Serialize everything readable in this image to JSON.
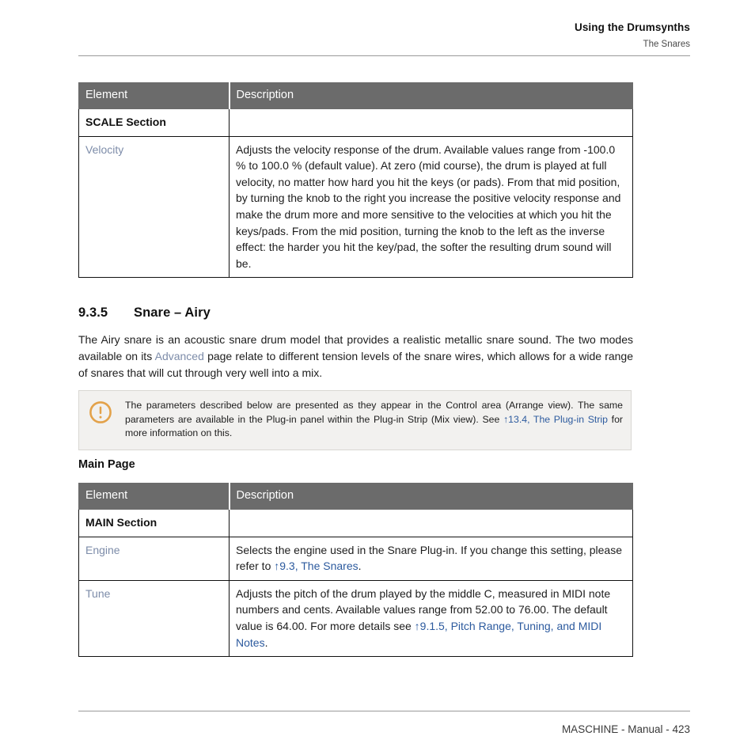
{
  "running_head": {
    "title": "Using the Drumsynths",
    "subtitle": "The Snares"
  },
  "tables": {
    "scale_table": {
      "columns": [
        "Element",
        "Description"
      ],
      "rows": [
        {
          "element": "SCALE Section",
          "element_style": "section",
          "description": ""
        },
        {
          "element": "Velocity",
          "element_style": "param",
          "description": "Adjusts the velocity response of the drum. Available values range from -100.0 % to 100.0 % (default value). At zero (mid course), the drum is played at full velocity, no matter how hard you hit the keys (or pads). From that mid position, by turning the knob to the right you increase the positive velocity response and make the drum more and more sensitive to the velocities at which you hit the keys/pads. From the mid position, turning the knob to the left as the inverse effect: the harder you hit the key/pad, the softer the resulting drum sound will be."
        }
      ]
    },
    "main_table": {
      "columns": [
        "Element",
        "Description"
      ],
      "rows": [
        {
          "element": "MAIN Section",
          "element_style": "section",
          "description": ""
        },
        {
          "element": "Engine",
          "element_style": "param",
          "description_pre": "Selects the engine used in the Snare Plug-in. If you change this setting, please refer to ",
          "description_link": "↑9.3, The Snares",
          "description_post": "."
        },
        {
          "element": "Tune",
          "element_style": "param",
          "description_pre": "Adjusts the pitch of the drum played by the middle C, measured in MIDI note numbers and cents. Available values range from 52.00 to 76.00. The default value is 64.00. For more details see ",
          "description_link": "↑9.1.5, Pitch Range, Tuning, and MIDI Notes",
          "description_post": "."
        }
      ]
    }
  },
  "section_heading": {
    "number": "9.3.5",
    "title": "Snare – Airy"
  },
  "intro_paragraph": {
    "part1": "The Airy snare is an acoustic snare drum model that provides a realistic metallic snare sound. The two modes available on its ",
    "link": "Advanced",
    "part2": " page relate to different tension levels of the snare wires, which allows for a wide range of snares that will cut through very well into a mix."
  },
  "note": {
    "icon": "exclamation-circle-icon",
    "icon_color": "#e3a24a",
    "text_pre": "The parameters described below are presented as they appear in the Control area (Arrange view). The same parameters are available in the Plug-in panel within the Plug-in Strip (Mix view). See ",
    "link": "↑13.4, The Plug-in Strip",
    "text_post": " for more information on this."
  },
  "subheading_main_page": "Main Page",
  "footer": {
    "text": "MASCHINE - Manual - 423"
  },
  "colors": {
    "table_header_bg": "#6b6b6b",
    "param_link": "#7d8ca9",
    "xref_link": "#2c5a9e",
    "note_bg": "#f2f1ef",
    "note_border": "#d9d7d3",
    "rule": "#9a9a9a"
  }
}
